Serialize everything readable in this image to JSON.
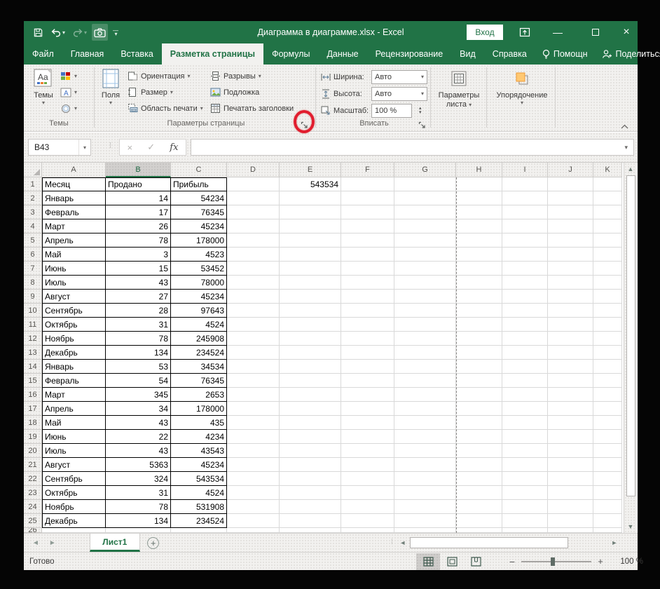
{
  "titlebar": {
    "title": "Диаграмма в диаграмме.xlsx  -  Excel",
    "sign_in_label": "Вход",
    "qat_icons": [
      "save-icon",
      "undo-icon",
      "redo-icon",
      "camera-icon",
      "customize-qat-icon"
    ]
  },
  "tabs": {
    "items": [
      {
        "label": "Файл",
        "active": false
      },
      {
        "label": "Главная",
        "active": false
      },
      {
        "label": "Вставка",
        "active": false
      },
      {
        "label": "Разметка страницы",
        "active": true
      },
      {
        "label": "Формулы",
        "active": false
      },
      {
        "label": "Данные",
        "active": false
      },
      {
        "label": "Рецензирование",
        "active": false
      },
      {
        "label": "Вид",
        "active": false
      },
      {
        "label": "Справка",
        "active": false
      }
    ],
    "assistant_label": "Помощн",
    "share_label": "Поделиться"
  },
  "ribbon": {
    "themes": {
      "group_label": "Темы",
      "themes_button": "Темы"
    },
    "page_setup": {
      "group_label": "Параметры страницы",
      "margins": "Поля",
      "orientation": "Ориентация",
      "size": "Размер",
      "print_area": "Область печати",
      "breaks": "Разрывы",
      "background": "Подложка",
      "print_titles": "Печатать заголовки"
    },
    "scale_to_fit": {
      "group_label": "Вписать",
      "width_label": "Ширина:",
      "width_value": "Авто",
      "height_label": "Высота:",
      "height_value": "Авто",
      "scale_label": "Масштаб:",
      "scale_value": "100 %"
    },
    "sheet_options": {
      "button_label_1": "Параметры",
      "button_label_2": "листа"
    },
    "arrange": {
      "button_label": "Упорядочение"
    }
  },
  "formula_bar": {
    "name_box": "B43",
    "cancel": "×",
    "enter": "✓",
    "fx_label": "fx",
    "formula_value": ""
  },
  "grid": {
    "columns": [
      "A",
      "B",
      "C",
      "D",
      "E",
      "F",
      "G",
      "H",
      "I",
      "J",
      "K"
    ],
    "selected_column": "B",
    "visible_rows": 26,
    "table": {
      "headers": [
        "Месяц",
        "Продано",
        "Прибыль"
      ],
      "rows": [
        [
          "Январь",
          14,
          54234
        ],
        [
          "Февраль",
          17,
          76345
        ],
        [
          "Март",
          26,
          45234
        ],
        [
          "Апрель",
          78,
          178000
        ],
        [
          "Май",
          3,
          4523
        ],
        [
          "Июнь",
          15,
          53452
        ],
        [
          "Июль",
          43,
          78000
        ],
        [
          "Август",
          27,
          45234
        ],
        [
          "Сентябрь",
          28,
          97643
        ],
        [
          "Октябрь",
          31,
          4524
        ],
        [
          "Ноябрь",
          78,
          245908
        ],
        [
          "Декабрь",
          134,
          234524
        ],
        [
          "Январь",
          53,
          34534
        ],
        [
          "Февраль",
          54,
          76345
        ],
        [
          "Март",
          345,
          2653
        ],
        [
          "Апрель",
          34,
          178000
        ],
        [
          "Май",
          43,
          435
        ],
        [
          "Июнь",
          22,
          4234
        ],
        [
          "Июль",
          43,
          43543
        ],
        [
          "Август",
          5363,
          45234
        ],
        [
          "Сентябрь",
          324,
          543534
        ],
        [
          "Октябрь",
          31,
          4524
        ],
        [
          "Ноябрь",
          78,
          531908
        ],
        [
          "Декабрь",
          134,
          234524
        ]
      ]
    },
    "loose_cells": {
      "E1": "543534"
    }
  },
  "sheet_bar": {
    "sheets": [
      {
        "name": "Лист1",
        "active": true
      }
    ],
    "add_sheet": "+"
  },
  "status_bar": {
    "status": "Готово",
    "zoom_percent": "100 %"
  },
  "annotation": {
    "color": "#e11d2e",
    "target": "page-setup-dialog-launcher"
  }
}
